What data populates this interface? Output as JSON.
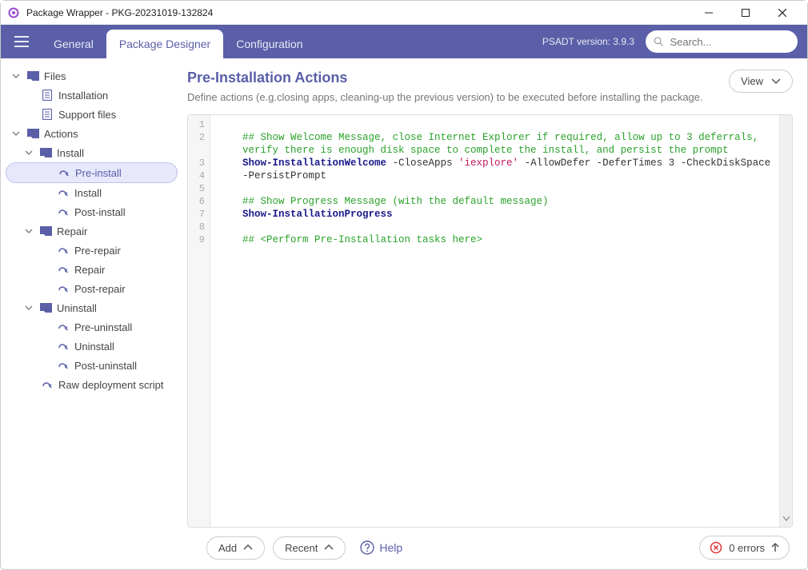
{
  "window": {
    "title": "Package Wrapper - PKG-20231019-132824"
  },
  "nav": {
    "tabs": {
      "general": "General",
      "designer": "Package Designer",
      "config": "Configuration"
    },
    "version_label": "PSADT version: 3.9.3",
    "search_placeholder": "Search..."
  },
  "tree": {
    "files": "Files",
    "installation": "Installation",
    "support_files": "Support files",
    "actions": "Actions",
    "install": "Install",
    "pre_install": "Pre-install",
    "install_step": "Install",
    "post_install": "Post-install",
    "repair": "Repair",
    "pre_repair": "Pre-repair",
    "repair_step": "Repair",
    "post_repair": "Post-repair",
    "uninstall": "Uninstall",
    "pre_uninstall": "Pre-uninstall",
    "uninstall_step": "Uninstall",
    "post_uninstall": "Post-uninstall",
    "raw_script": "Raw deployment script"
  },
  "content": {
    "title": "Pre-Installation Actions",
    "subtitle": "Define actions (e.g.closing apps, cleaning-up the previous version) to be executed before installing the package.",
    "view_label": "View"
  },
  "editor": {
    "line_numbers": [
      "1",
      "2",
      "3",
      "4",
      "5",
      "6",
      "7",
      "8",
      "9"
    ],
    "comment1": "## Show Welcome Message, close Internet Explorer if required, allow up to 3 deferrals, verify there is enough disk space to complete the install, and persist the prompt",
    "cmd1": "Show-InstallationWelcome",
    "cmd1_rest_a": " -CloseApps ",
    "cmd1_string": "'iexplore'",
    "cmd1_rest_b": " -AllowDefer -DeferTimes 3 -CheckDiskSpace -PersistPrompt",
    "comment2": "## Show Progress Message (with the default message)",
    "cmd2": "Show-InstallationProgress",
    "comment3": "## <Perform Pre-Installation tasks here>"
  },
  "bottom": {
    "add": "Add",
    "recent": "Recent",
    "help": "Help",
    "errors": "0 errors"
  }
}
